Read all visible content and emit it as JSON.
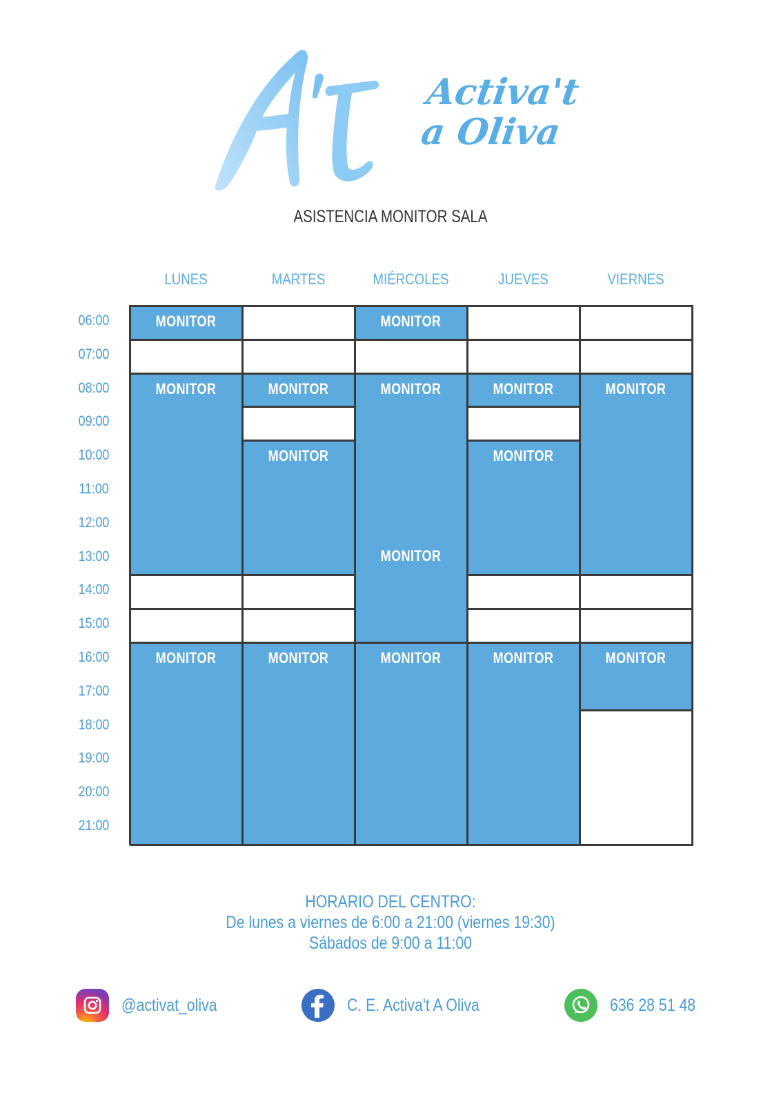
{
  "logo": {
    "mark": "A't",
    "line1": "Activa't",
    "line2": "a Oliva",
    "colors": {
      "light": "#a9d8f8",
      "mid": "#5aaee6"
    }
  },
  "title": "ASISTENCIA MONITOR SALA",
  "days": [
    "LUNES",
    "MARTES",
    "MIÉRCOLES",
    "JUEVES",
    "VIERNES"
  ],
  "times": [
    "06:00",
    "07:00",
    "08:00",
    "09:00",
    "10:00",
    "11:00",
    "12:00",
    "13:00",
    "14:00",
    "15:00",
    "16:00",
    "17:00",
    "18:00",
    "19:00",
    "20:00",
    "21:00"
  ],
  "schedule": {
    "LUNES": [
      {
        "start": "06:00",
        "end": "07:00",
        "label": "MONITOR"
      },
      {
        "start": "08:00",
        "end": "14:00",
        "label": "MONITOR"
      },
      {
        "start": "16:00",
        "end": "21:00",
        "label": "MONITOR"
      }
    ],
    "MARTES": [
      {
        "start": "08:00",
        "end": "09:00",
        "label": "MONITOR"
      },
      {
        "start": "10:00",
        "end": "14:00",
        "label": "MONITOR"
      },
      {
        "start": "16:00",
        "end": "21:00",
        "label": "MONITOR"
      }
    ],
    "MIÉRCOLES": [
      {
        "start": "06:00",
        "end": "07:00",
        "label": "MONITOR"
      },
      {
        "start": "08:00",
        "end": "16:00",
        "label": "MONITOR",
        "extra_label": "MONITOR"
      },
      {
        "start": "16:00",
        "end": "21:00",
        "label": "MONITOR"
      }
    ],
    "JUEVES": [
      {
        "start": "08:00",
        "end": "09:00",
        "label": "MONITOR"
      },
      {
        "start": "10:00",
        "end": "14:00",
        "label": "MONITOR"
      },
      {
        "start": "16:00",
        "end": "21:00",
        "label": "MONITOR"
      }
    ],
    "VIERNES": [
      {
        "start": "08:00",
        "end": "14:00",
        "label": "MONITOR"
      },
      {
        "start": "16:00",
        "end": "18:00",
        "label": "MONITOR"
      }
    ]
  },
  "colors": {
    "slot_on": "#5daadf",
    "slot_off": "#ffffff",
    "grid_line": "#3a3a3a",
    "accent_text": "#4a9bd8"
  },
  "footer": {
    "heading": "HORARIO DEL CENTRO:",
    "line1": "De lunes a viernes de 6:00 a 21:00 (viernes 19:30)",
    "line2": "Sábados de 9:00 a 11:00"
  },
  "social": {
    "instagram": "@activat_oliva",
    "facebook": "C. E. Activa't A Oliva",
    "whatsapp": "636 28 51 48"
  }
}
